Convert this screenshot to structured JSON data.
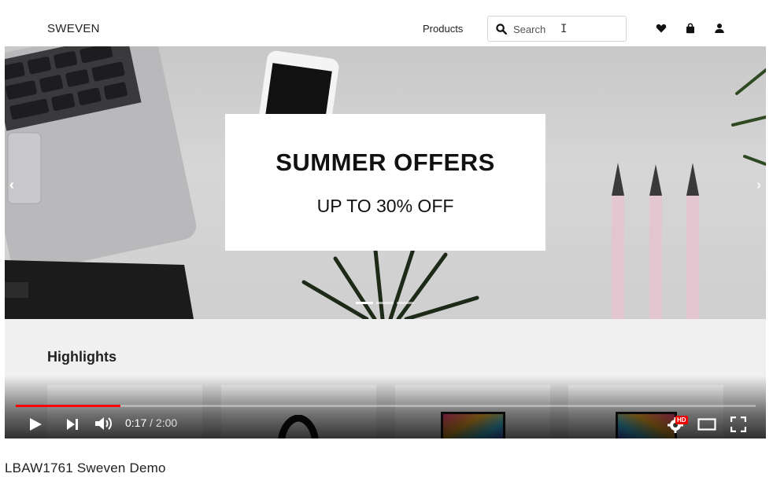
{
  "site": {
    "brand": "SWEVEN",
    "nav_products": "Products",
    "search_placeholder": "Search"
  },
  "hero": {
    "title": "SUMMER OFFERS",
    "subtitle": "UP TO 30% OFF",
    "slide_count": 3,
    "active_slide": 1
  },
  "highlights": {
    "title": "Highlights"
  },
  "player": {
    "current_time": "0:17",
    "duration": "2:00",
    "progress": 0.1417,
    "hd_badge": "HD"
  },
  "video_title": "LBAW1761 Sweven Demo",
  "icons": {
    "search": "search-icon",
    "wishlist": "heart-icon",
    "cart": "shopping-bag-icon",
    "account": "user-icon"
  },
  "colors": {
    "progress_red": "#ff0000",
    "card_bg": "#ffffff",
    "highlights_bg": "#f0f0f0"
  }
}
